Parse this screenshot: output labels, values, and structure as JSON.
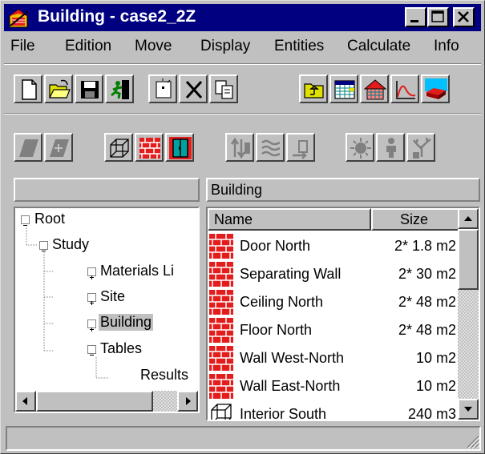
{
  "window": {
    "title": "Building - case2_2Z"
  },
  "menu": [
    "File",
    "Edition",
    "Move",
    "Display",
    "Entities",
    "Calculate",
    "Info"
  ],
  "toolbar1": [
    {
      "icon": "new-document-icon"
    },
    {
      "icon": "open-folder-icon"
    },
    {
      "icon": "save-disk-icon"
    },
    {
      "icon": "exit-running-man-icon"
    },
    {
      "icon": "new-item-icon"
    },
    {
      "icon": "delete-x-icon"
    },
    {
      "icon": "copy-icon"
    },
    {
      "icon": "parent-folder-icon"
    },
    {
      "icon": "table-grid-icon"
    },
    {
      "icon": "building-icon"
    },
    {
      "icon": "chart-curve-icon"
    },
    {
      "icon": "3d-view-icon"
    }
  ],
  "toolbar2": [
    {
      "icon": "shape-gray-icon"
    },
    {
      "icon": "split-gray-icon"
    },
    {
      "icon": "cube-wireframe-icon"
    },
    {
      "icon": "brick-wall-icon"
    },
    {
      "icon": "door-icon"
    },
    {
      "icon": "arrows-gray-icon"
    },
    {
      "icon": "waves-gray-icon"
    },
    {
      "icon": "arrow-in-gray-icon"
    },
    {
      "icon": "sun-gray-icon"
    },
    {
      "icon": "person-gray-icon"
    },
    {
      "icon": "tree-gray-icon"
    }
  ],
  "left_panel": {
    "header": ""
  },
  "tree": [
    {
      "label": "Root",
      "expander": "−"
    },
    {
      "label": "Study",
      "expander": "−"
    },
    {
      "label": "Materials Li",
      "expander": "+"
    },
    {
      "label": "Site",
      "expander": "+"
    },
    {
      "label": "Building",
      "expander": "+",
      "selected": true
    },
    {
      "label": "Tables",
      "expander": "−"
    },
    {
      "label": "Results",
      "expander": ""
    }
  ],
  "right_panel": {
    "header": "Building"
  },
  "list": {
    "columns": [
      "Name",
      "Size"
    ],
    "rows": [
      {
        "icon": "wall-brick-icon",
        "name": "Door North",
        "size": "2* 1.8 m2"
      },
      {
        "icon": "wall-brick-icon",
        "name": "Separating Wall",
        "size": "2* 30 m2"
      },
      {
        "icon": "wall-brick-icon",
        "name": "Ceiling North",
        "size": "2* 48 m2"
      },
      {
        "icon": "wall-brick-icon",
        "name": "Floor North",
        "size": "2* 48 m2"
      },
      {
        "icon": "wall-brick-icon",
        "name": "Wall West-North",
        "size": "10 m2"
      },
      {
        "icon": "wall-brick-icon",
        "name": "Wall East-North",
        "size": "10 m2"
      },
      {
        "icon": "cube-wireframe-icon",
        "name": "Interior South",
        "size": "240 m3"
      }
    ]
  },
  "status": {
    "text": ""
  },
  "colors": {
    "titlebar": "#000080",
    "face": "#c0c0c0",
    "brick": "#e31c1c"
  }
}
